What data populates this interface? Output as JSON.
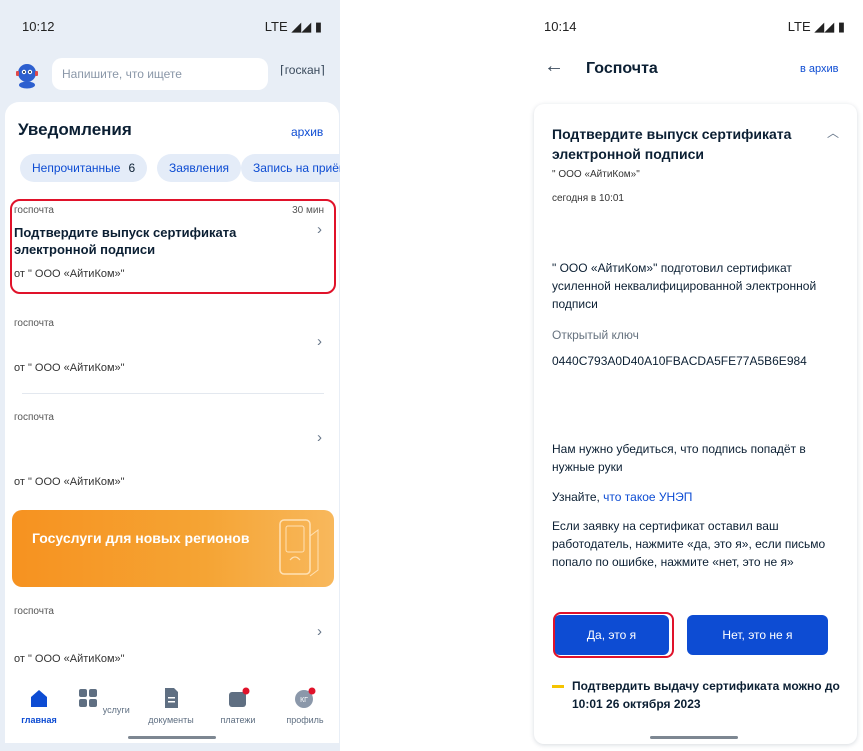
{
  "left": {
    "status": {
      "time": "10:12",
      "signal": "LTE ◢◢ ▮"
    },
    "search": {
      "placeholder": "Напишите, что ищете",
      "scan_label": "госкан"
    },
    "section_title": "Уведомления",
    "archive_label": "архив",
    "chips": [
      {
        "label": "Непрочитанные",
        "count": "6"
      },
      {
        "label": "Заявления"
      },
      {
        "label": "Запись на приём"
      }
    ],
    "notifications": [
      {
        "source": "госпочта",
        "time": "30 мин",
        "title": "Подтвердите выпуск сертификата электронной подписи",
        "from": "от \" ООО «АйтиКом»\""
      },
      {
        "source": "госпочта",
        "from": "от \" ООО «АйтиКом»\""
      },
      {
        "source": "госпочта",
        "from": "от \" ООО «АйтиКом»\""
      },
      {
        "source": "госпочта",
        "from": "от \" ООО «АйтиКом»\""
      }
    ],
    "banner": "Госуслуги для новых регионов",
    "tabs": [
      {
        "label": "главная",
        "icon": "home-icon"
      },
      {
        "label": "услуги",
        "icon": "grid-icon"
      },
      {
        "label": "документы",
        "icon": "document-icon"
      },
      {
        "label": "платежи",
        "icon": "wallet-icon"
      },
      {
        "label": "профиль",
        "icon": "avatar-icon",
        "initials": "КГ"
      }
    ]
  },
  "right": {
    "status": {
      "time": "10:14",
      "signal": "LTE ◢◢ ▮"
    },
    "title": "Госпочта",
    "archive_label": "в архив",
    "message": {
      "title": "Подтвердите выпуск сертификата электронной подписи",
      "sender": "\" ООО «АйтиКом»\"",
      "date": "сегодня в 10:01",
      "intro": "\" ООО «АйтиКом»\" подготовил сертификат усиленной неквалифицированной электронной подписи",
      "key_label": "Открытый ключ",
      "key_value": "0440C793A0D40A10FBACDA5FE77A5B6E984",
      "verify_text": "Нам нужно убедиться, что подпись попадёт в нужные руки",
      "learn_prefix": "Узнайте, ",
      "learn_link": "что такое УНЭП",
      "instructions": "Если заявку на сертификат оставил ваш работодатель, нажмите «да, это я», если письмо попало по ошибке, нажмите «нет, это не я»",
      "yes_button": "Да, это я",
      "no_button": "Нет, это не я",
      "deadline": "Подтвердить выдачу сертификата можно до 10:01 26 октября 2023"
    }
  },
  "colors": {
    "accent": "#0d4cd3",
    "highlight": "#e0122a",
    "banner": "#f69220",
    "deadline_bar": "#f5c400"
  }
}
